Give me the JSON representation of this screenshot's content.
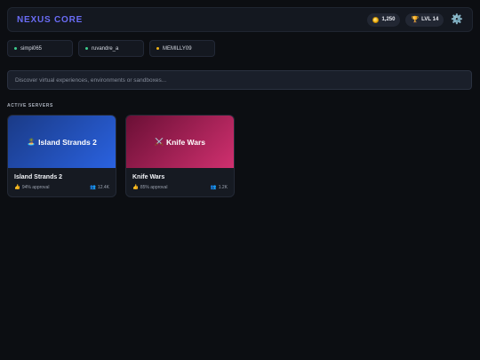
{
  "header": {
    "brand": "NEXUS CORE",
    "currency": "1,250",
    "level": "LVL 14",
    "icons": {
      "coin": "coin-icon",
      "trophy": "trophy-icon",
      "settings": "gear-icon"
    }
  },
  "friends": [
    {
      "name": "simpi065",
      "status_color": "#3ecf8e"
    },
    {
      "name": "ruvandre_a",
      "status_color": "#3ecf8e"
    },
    {
      "name": "MEMILLY09",
      "status_color": "#f2b414"
    }
  ],
  "search": {
    "placeholder": "Discover virtual experiences, environments or sandboxes..."
  },
  "servers": {
    "section_title": "ACTIVE SERVERS",
    "items": [
      {
        "thumb_label": "Island Strands 2",
        "thumb_icon": "🏝️",
        "name": "Island Strands 2",
        "approval": "94% approval",
        "players": "12.4K",
        "gradient": [
          "#1a3a86",
          "#2a62e0"
        ]
      },
      {
        "thumb_label": "Knife Wars",
        "thumb_icon": "⚔️",
        "name": "Knife Wars",
        "approval": "85% approval",
        "players": "1.2K",
        "gradient": [
          "#6a0f35",
          "#d0306f"
        ]
      }
    ]
  },
  "colors": {
    "accent": "#6a6cf5",
    "background": "#0c0e12"
  }
}
